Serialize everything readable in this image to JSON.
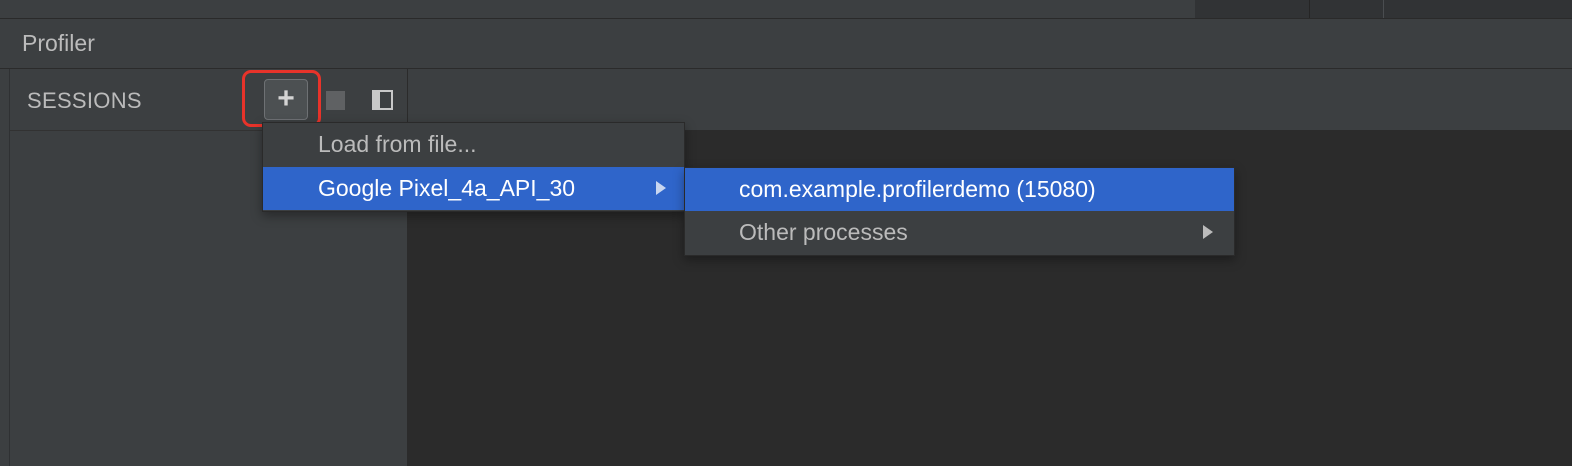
{
  "window": {
    "title": "Profiler"
  },
  "sessions": {
    "label": "SESSIONS",
    "add_button": {
      "glyph": "+",
      "icon": "plus-icon"
    },
    "stop_button": {
      "icon": "stop-icon"
    },
    "toggle_panel_button": {
      "icon": "panel-collapse-icon"
    }
  },
  "menu": {
    "items": [
      {
        "label": "Load from file..."
      },
      {
        "label": "Google Pixel_4a_API_30",
        "has_submenu": true,
        "selected": true
      }
    ]
  },
  "submenu": {
    "items": [
      {
        "label": "com.example.profilerdemo (15080)",
        "selected": true
      },
      {
        "label": "Other processes",
        "has_submenu": true
      }
    ]
  },
  "colors": {
    "selection": "#2f65ca",
    "highlight": "#e8332a",
    "panel": "#3c3f41",
    "background": "#2b2b2b"
  }
}
